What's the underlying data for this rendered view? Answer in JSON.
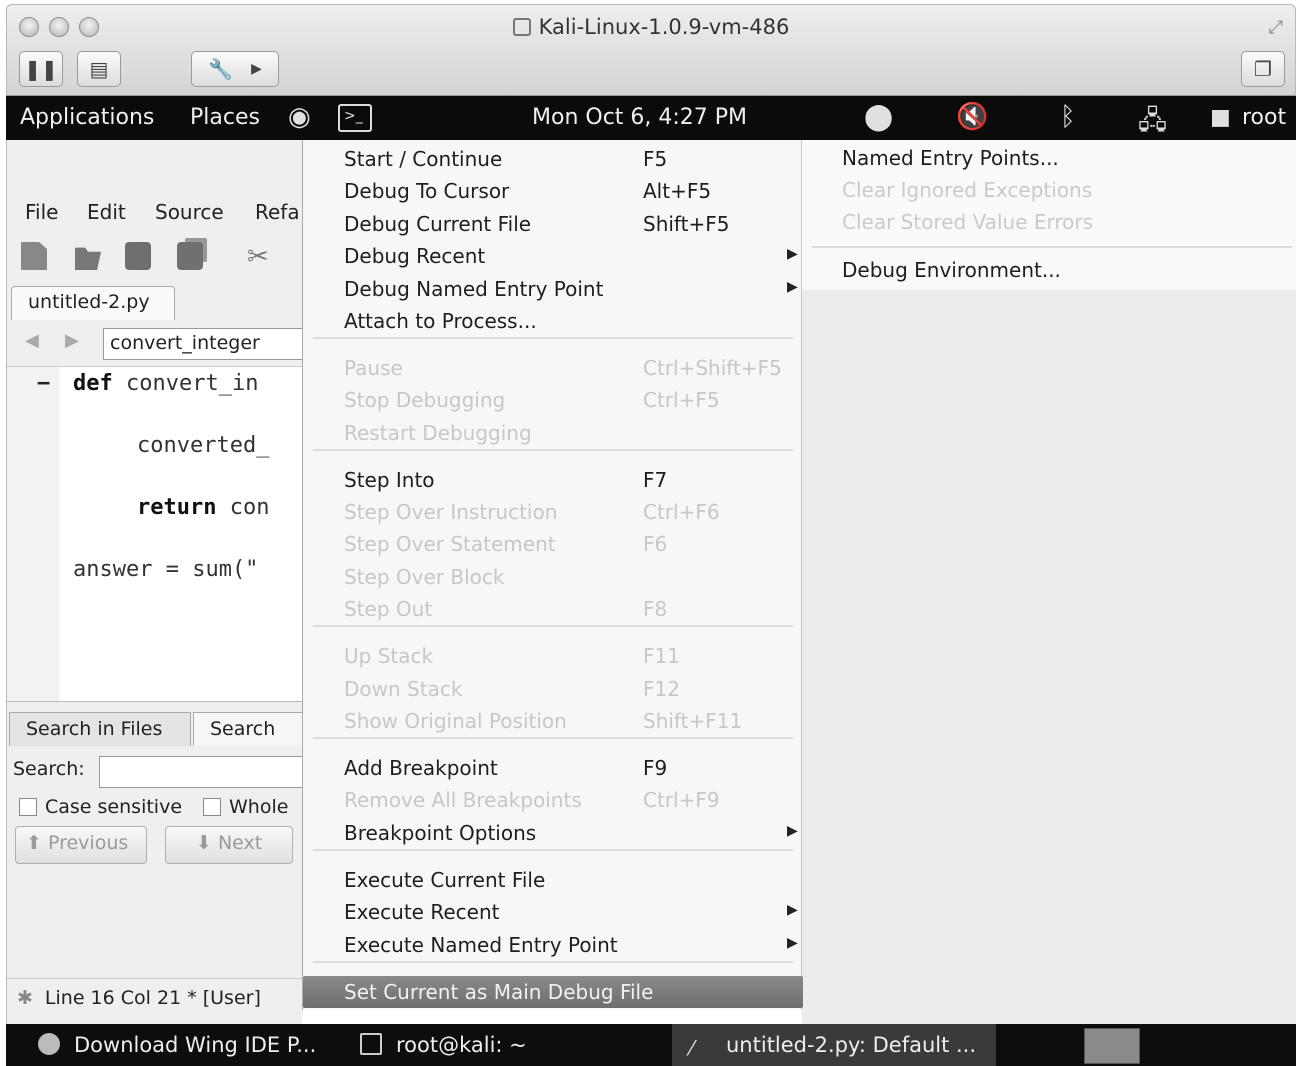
{
  "vm_window": {
    "title": "Kali-Linux-1.0.9-vm-486"
  },
  "top_panel": {
    "applications": "Applications",
    "places": "Places",
    "clock": "Mon Oct  6,  4:27 PM",
    "user": "root"
  },
  "ide": {
    "menubar": {
      "file": "File",
      "edit": "Edit",
      "source": "Source",
      "refactor": "Refa"
    },
    "editor_tab": "untitled-2.py",
    "function_select": "convert_integer",
    "code_lines": [
      {
        "kw": "def",
        "rest": " convert_in"
      },
      {
        "kw": "",
        "rest": "converted_"
      },
      {
        "kw": "return",
        "rest": " con"
      },
      {
        "kw": "",
        "rest": "answer = sum(\""
      }
    ],
    "search": {
      "tab_search_in_files": "Search in Files",
      "tab_search": "Search",
      "label": "Search:",
      "value": "",
      "case_sensitive": "Case sensitive",
      "whole": "Whole ",
      "previous": "Previous",
      "next": "Next"
    },
    "status": "Line 16 Col 21 * [User]"
  },
  "debug_menu": {
    "items": [
      {
        "label": "Start / Continue",
        "shortcut": "F5"
      },
      {
        "label": "Debug To Cursor",
        "shortcut": "Alt+F5"
      },
      {
        "label": "Debug Current File",
        "shortcut": "Shift+F5"
      },
      {
        "label": "Debug Recent",
        "shortcut": ""
      },
      {
        "label": "Debug Named Entry Point",
        "shortcut": ""
      },
      {
        "label": "Attach to Process...",
        "shortcut": ""
      },
      {
        "label": "Pause",
        "shortcut": "Ctrl+Shift+F5"
      },
      {
        "label": "Stop Debugging",
        "shortcut": "Ctrl+F5"
      },
      {
        "label": "Restart Debugging",
        "shortcut": ""
      },
      {
        "label": "Step Into",
        "shortcut": "F7"
      },
      {
        "label": "Step Over Instruction",
        "shortcut": "Ctrl+F6"
      },
      {
        "label": "Step Over Statement",
        "shortcut": "F6"
      },
      {
        "label": "Step Over Block",
        "shortcut": ""
      },
      {
        "label": "Step Out",
        "shortcut": "F8"
      },
      {
        "label": "Up Stack",
        "shortcut": "F11"
      },
      {
        "label": "Down Stack",
        "shortcut": "F12"
      },
      {
        "label": "Show Original Position",
        "shortcut": "Shift+F11"
      },
      {
        "label": "Add Breakpoint",
        "shortcut": "F9"
      },
      {
        "label": "Remove All Breakpoints",
        "shortcut": "Ctrl+F9"
      },
      {
        "label": "Breakpoint Options",
        "shortcut": ""
      },
      {
        "label": "Execute Current File",
        "shortcut": ""
      },
      {
        "label": "Execute Recent",
        "shortcut": ""
      },
      {
        "label": "Execute Named Entry Point",
        "shortcut": ""
      },
      {
        "label": "Set Current as Main Debug File",
        "shortcut": ""
      }
    ]
  },
  "submenu": {
    "named_entry_points": "Named Entry Points...",
    "clear_ignored_exceptions": "Clear Ignored Exceptions",
    "clear_stored_value_errors": "Clear Stored Value Errors",
    "debug_environment": "Debug Environment..."
  },
  "taskbar": {
    "task1": "Download Wing IDE P...",
    "task2": "root@kali: ~",
    "task3": "untitled-2.py: Default ..."
  }
}
